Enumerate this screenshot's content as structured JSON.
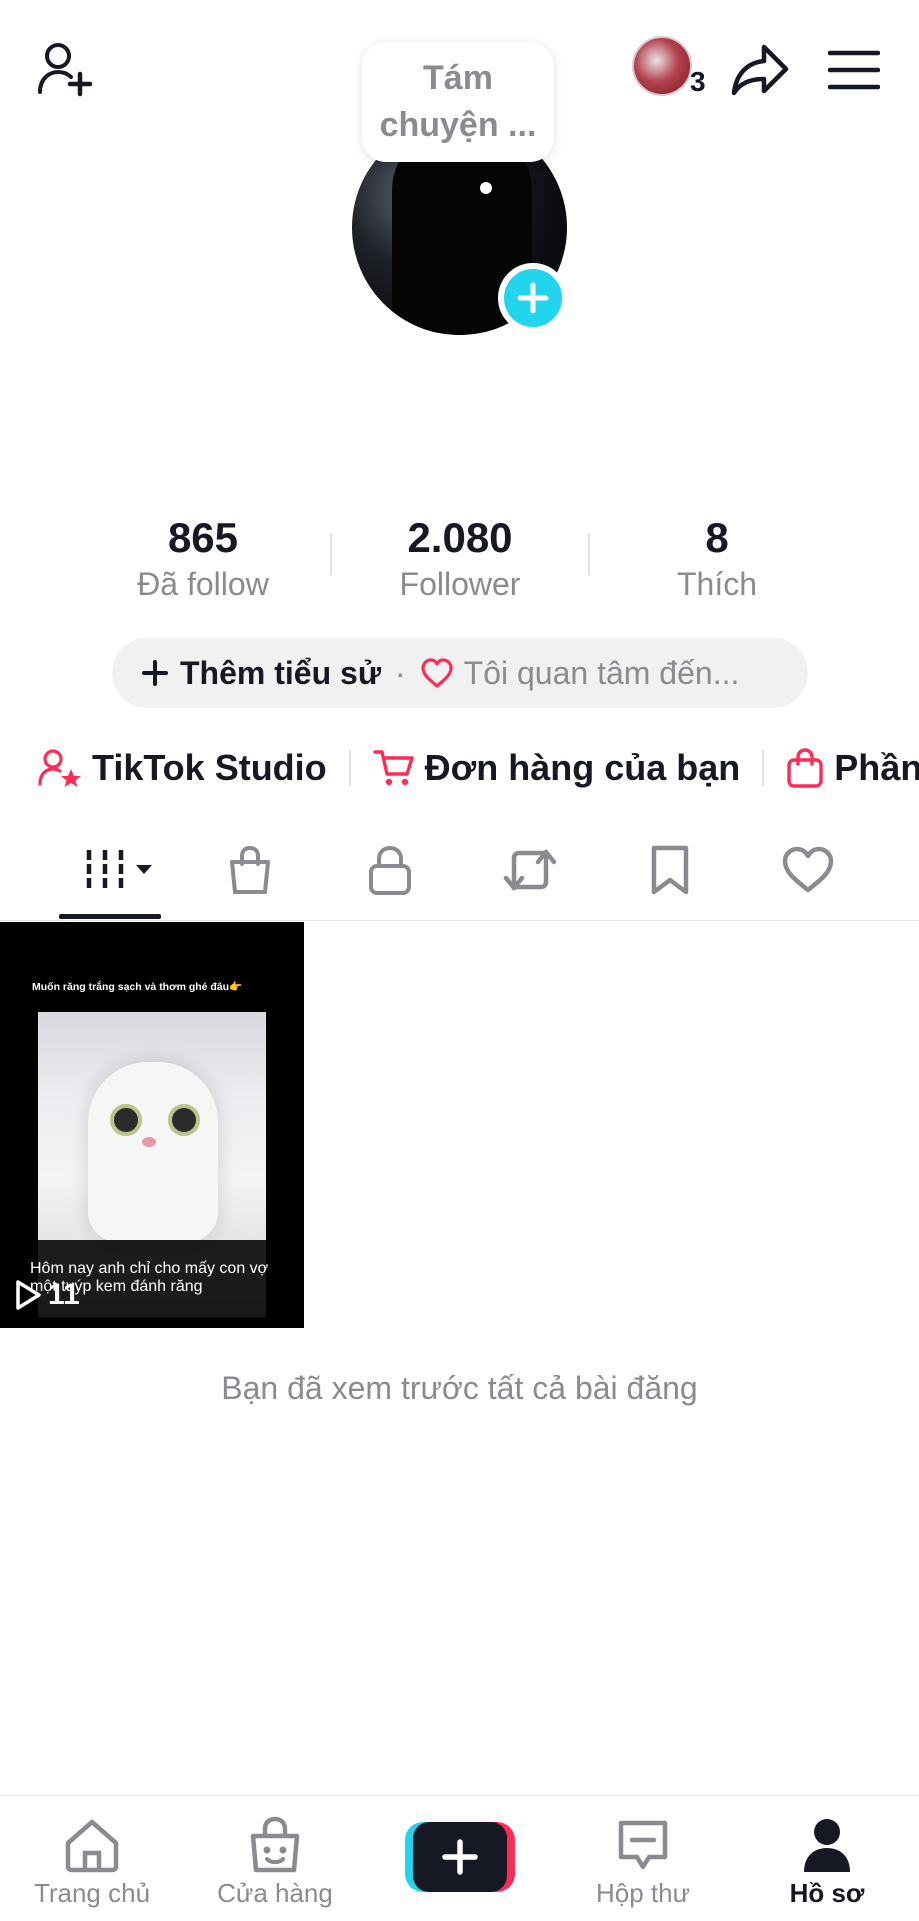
{
  "header": {
    "add_friend_icon": "person-add-icon",
    "story_badge_count": "3",
    "share_icon": "share-arrow-icon",
    "menu_icon": "hamburger-menu-icon"
  },
  "profile": {
    "bubble_text": "Tám chuyện ...",
    "add_avatar_icon": "plus-icon"
  },
  "stats": [
    {
      "value": "865",
      "label": "Đã follow"
    },
    {
      "value": "2.080",
      "label": "Follower"
    },
    {
      "value": "8",
      "label": "Thích"
    }
  ],
  "bio": {
    "add_bio": "Thêm tiểu sử",
    "separator": "·",
    "interest": "Tôi quan tâm đến..."
  },
  "links": [
    {
      "label": "TikTok Studio",
      "icon": "person-star-icon"
    },
    {
      "label": "Đơn hàng của bạn",
      "icon": "cart-icon"
    },
    {
      "label": "Phần",
      "icon": "shopping-bag-icon"
    }
  ],
  "tabs": [
    {
      "icon": "grid-icon",
      "active": true
    },
    {
      "icon": "shop-bag-icon"
    },
    {
      "icon": "lock-icon"
    },
    {
      "icon": "repost-icon"
    },
    {
      "icon": "bookmark-icon"
    },
    {
      "icon": "heart-icon"
    }
  ],
  "videos": [
    {
      "top_caption": "Muốn răng trắng sạch và thơm ghé đâu👉",
      "bottom_caption": "Hôm nay anh chỉ cho mấy con vợ một tuýp kem đánh răng",
      "views": "11"
    }
  ],
  "seen_all": "Bạn đã xem trước tất cả bài đăng",
  "bottom_nav": [
    {
      "label": "Trang chủ",
      "icon": "home-icon"
    },
    {
      "label": "Cửa hàng",
      "icon": "shop-icon"
    },
    {
      "label": "",
      "icon": "create-plus-icon"
    },
    {
      "label": "Hộp thư",
      "icon": "inbox-icon"
    },
    {
      "label": "Hồ sơ",
      "icon": "profile-icon",
      "active": true
    }
  ],
  "colors": {
    "accent_cyan": "#20d5ec",
    "accent_red": "#fe2c55",
    "text_primary": "#161823",
    "text_secondary": "#8a8b91"
  }
}
